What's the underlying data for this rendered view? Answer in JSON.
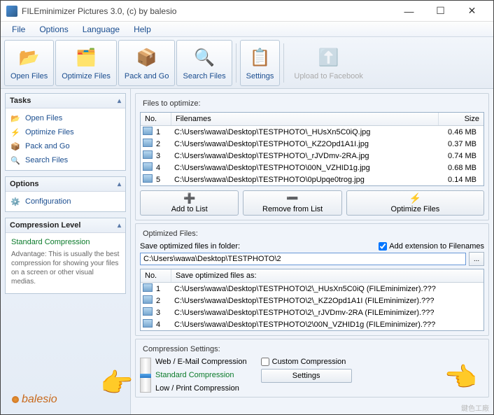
{
  "window": {
    "title": "FILEminimizer Pictures 3.0, (c) by balesio",
    "controls": {
      "min": "—",
      "max": "☐",
      "close": "✕"
    }
  },
  "menubar": [
    "File",
    "Options",
    "Language",
    "Help"
  ],
  "toolbar": [
    {
      "label": "Open Files",
      "icon": "📂",
      "active": true
    },
    {
      "label": "Optimize Files",
      "icon": "🗂️",
      "active": true
    },
    {
      "label": "Pack and Go",
      "icon": "📦",
      "active": true
    },
    {
      "label": "Search Files",
      "icon": "🔍",
      "active": true
    },
    {
      "label": "Settings",
      "icon": "📋",
      "active": true,
      "sep_before": true
    },
    {
      "label": "Upload to Facebook",
      "icon": "⬆️",
      "active": false,
      "sep_before": true
    }
  ],
  "sidebar": {
    "tasks": {
      "title": "Tasks",
      "items": [
        {
          "icon": "📂",
          "label": "Open Files"
        },
        {
          "icon": "⚡",
          "label": "Optimize Files"
        },
        {
          "icon": "📦",
          "label": "Pack and Go"
        },
        {
          "icon": "🔍",
          "label": "Search Files"
        }
      ]
    },
    "options": {
      "title": "Options",
      "items": [
        {
          "icon": "⚙️",
          "label": "Configuration"
        }
      ]
    },
    "compression": {
      "title": "Compression Level",
      "subtitle": "Standard Compression",
      "text": "Advantage: This is usually the best compression for showing your files on a screen or other visual medias."
    },
    "logo": "balesio"
  },
  "files_to_optimize": {
    "label": "Files to optimize:",
    "cols": {
      "no": "No.",
      "filenames": "Filenames",
      "size": "Size"
    },
    "rows": [
      {
        "no": "1",
        "name": "C:\\Users\\wawa\\Desktop\\TESTPHOTO\\_HUsXn5C0iQ.jpg",
        "size": "0.46 MB"
      },
      {
        "no": "2",
        "name": "C:\\Users\\wawa\\Desktop\\TESTPHOTO\\_KZ2Opd1A1I.jpg",
        "size": "0.37 MB"
      },
      {
        "no": "3",
        "name": "C:\\Users\\wawa\\Desktop\\TESTPHOTO\\_rJVDmv-2RA.jpg",
        "size": "0.74 MB"
      },
      {
        "no": "4",
        "name": "C:\\Users\\wawa\\Desktop\\TESTPHOTO\\00N_VZHID1g.jpg",
        "size": "0.68 MB"
      },
      {
        "no": "5",
        "name": "C:\\Users\\wawa\\Desktop\\TESTPHOTO\\0pUpqe0trog.jpg",
        "size": "0.14 MB"
      }
    ],
    "buttons": {
      "add": {
        "icon": "➕",
        "label": "Add to List"
      },
      "remove": {
        "icon": "➖",
        "label": "Remove from List"
      },
      "optimize": {
        "icon": "⚡",
        "label": "Optimize Files"
      }
    }
  },
  "optimized_files": {
    "label": "Optimized Files:",
    "save_in_label": "Save optimized files in folder:",
    "folder": "C:\\Users\\wawa\\Desktop\\TESTPHOTO\\2",
    "add_ext": "Add extension to Filenames",
    "browse": "...",
    "cols": {
      "no": "No.",
      "saveas": "Save optimized files as:"
    },
    "rows": [
      {
        "no": "1",
        "name": "C:\\Users\\wawa\\Desktop\\TESTPHOTO\\2\\_HUsXn5C0iQ (FILEminimizer).???"
      },
      {
        "no": "2",
        "name": "C:\\Users\\wawa\\Desktop\\TESTPHOTO\\2\\_KZ2Opd1A1I (FILEminimizer).???"
      },
      {
        "no": "3",
        "name": "C:\\Users\\wawa\\Desktop\\TESTPHOTO\\2\\_rJVDmv-2RA (FILEminimizer).???"
      },
      {
        "no": "4",
        "name": "C:\\Users\\wawa\\Desktop\\TESTPHOTO\\2\\00N_VZHID1g (FILEminimizer).???"
      }
    ]
  },
  "compression_settings": {
    "label": "Compression Settings:",
    "levels": [
      "Web / E-Mail Compression",
      "Standard Compression",
      "Low / Print Compression"
    ],
    "custom": "Custom Compression",
    "settings_btn": "Settings"
  },
  "watermark": "鍵色工廠"
}
